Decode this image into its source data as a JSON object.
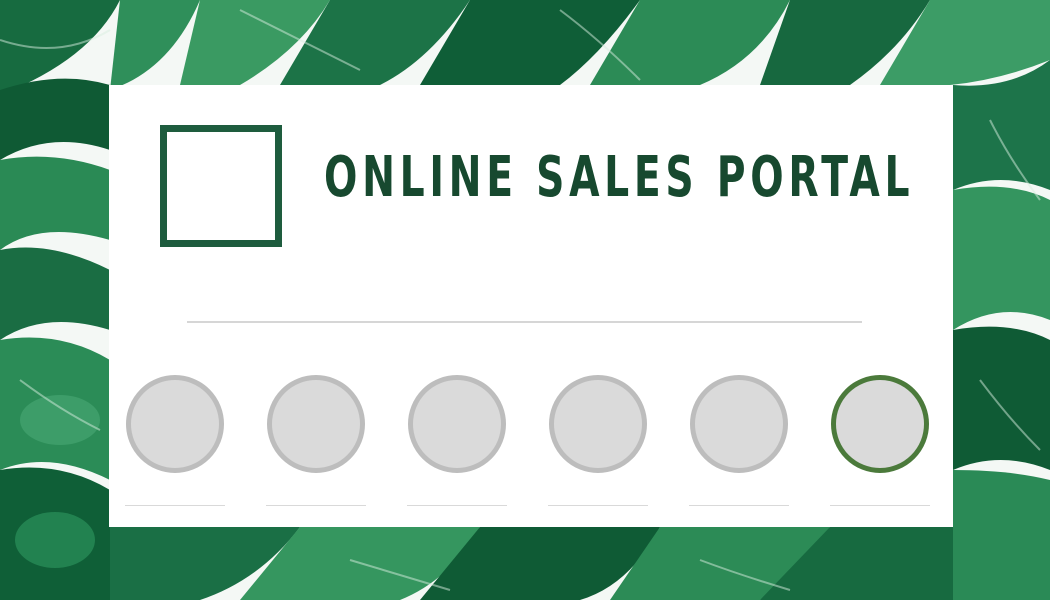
{
  "page": {
    "title": "ONLINE SALES PORTAL"
  },
  "options": [
    {
      "id": "option-1",
      "active": false
    },
    {
      "id": "option-2",
      "active": false
    },
    {
      "id": "option-3",
      "active": false
    },
    {
      "id": "option-4",
      "active": false
    },
    {
      "id": "option-5",
      "active": false
    },
    {
      "id": "option-6",
      "active": true
    }
  ],
  "colors": {
    "brand_dark": "#17492f",
    "logo_border": "#1e5c3e",
    "option_fill": "#dadada",
    "option_border": "#bdbdbd",
    "option_active_border": "#4b7a3b"
  }
}
